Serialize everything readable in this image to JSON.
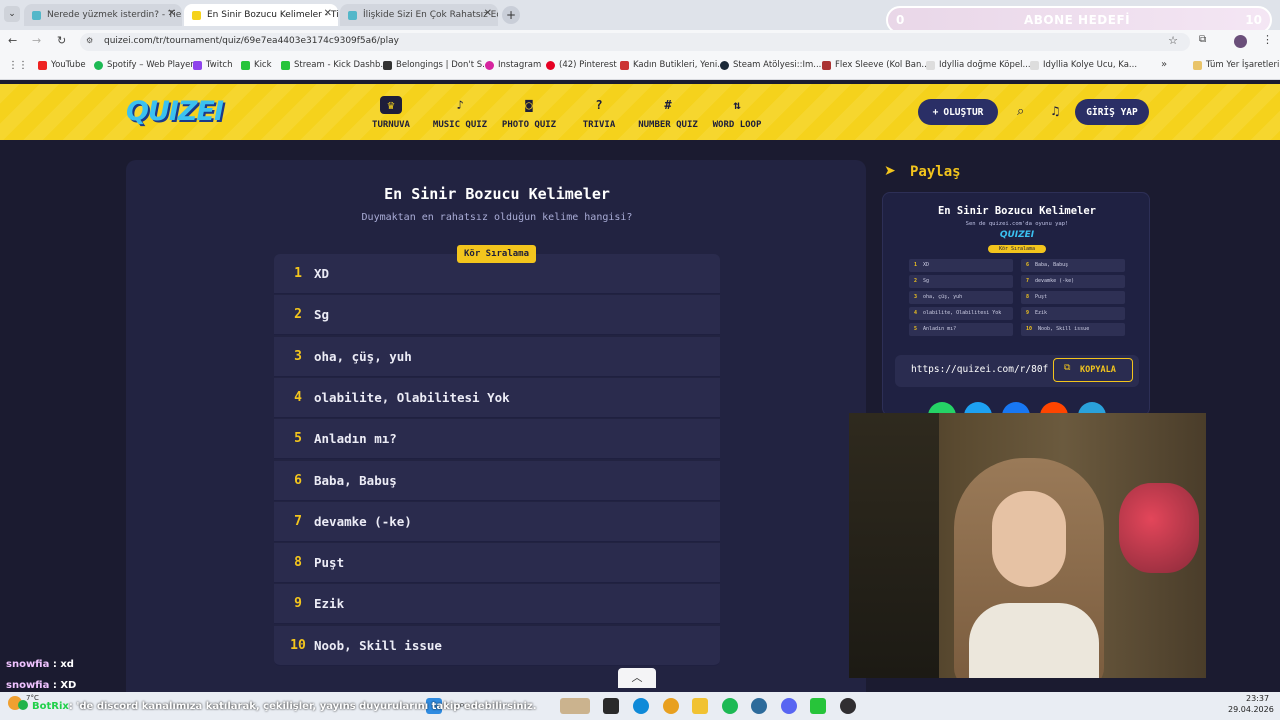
{
  "browser": {
    "tabs": [
      {
        "label": "Nerede yüzmek isterdin? - Tier"
      },
      {
        "label": "En Sinir Bozucu Kelimeler - Tier"
      },
      {
        "label": "İlişkide Sizi En Çok Rahatsız Eden"
      }
    ],
    "url": "quizei.com/tr/tournament/quiz/69e7ea4403e3174c9309f5a6/play",
    "bookmarks": [
      "YouTube",
      "Spotify – Web Player",
      "Twitch",
      "Kick",
      "Stream - Kick Dashb...",
      "Belongings | Don't S...",
      "Instagram",
      "(42) Pinterest",
      "Kadın Butikleri, Yeni...",
      "Steam Atölyesi::Im...",
      "Flex Sleeve (Kol Ban...",
      "Idyllia doğme Köpel...",
      "Idyllia Kolye Ucu, Ka..."
    ],
    "all_bookmarks": "Tüm Yer İşaretleri"
  },
  "overlay_goal": {
    "left": "0",
    "label": "ABONE HEDEFİ",
    "right": "10"
  },
  "site": {
    "logo": "QUIZEI",
    "nav": [
      {
        "label": "TURNUVA",
        "icon": "trophy-icon"
      },
      {
        "label": "MUSIC QUIZ",
        "icon": "music-note-icon"
      },
      {
        "label": "PHOTO QUIZ",
        "icon": "camera-icon"
      },
      {
        "label": "TRIVIA",
        "icon": "question-icon"
      },
      {
        "label": "NUMBER QUIZ",
        "icon": "hash-icon"
      },
      {
        "label": "WORD LOOP",
        "icon": "sort-icon"
      }
    ],
    "create_label": "OLUŞTUR",
    "login_label": "GİRİŞ YAP"
  },
  "quiz": {
    "title": "En Sinir Bozucu Kelimeler",
    "subtitle": "Duymaktan en rahatsız olduğun kelime hangisi?",
    "badge": "Kör Sıralama",
    "items": [
      {
        "rank": "1",
        "text": "XD"
      },
      {
        "rank": "2",
        "text": "Sg"
      },
      {
        "rank": "3",
        "text": "oha, çüş, yuh"
      },
      {
        "rank": "4",
        "text": "olabilite, Olabilitesi Yok"
      },
      {
        "rank": "5",
        "text": "Anladın mı?"
      },
      {
        "rank": "6",
        "text": "Baba, Babuş"
      },
      {
        "rank": "7",
        "text": "devamke (-ke)"
      },
      {
        "rank": "8",
        "text": "Puşt"
      },
      {
        "rank": "9",
        "text": "Ezik"
      },
      {
        "rank": "10",
        "text": "Noob, Skill issue"
      }
    ]
  },
  "share": {
    "heading": "Paylaş",
    "card_title": "En Sinir Bozucu Kelimeler",
    "card_subtitle": "Sen de quizei.com'da oyunu yap!",
    "card_logo": "QUIZEI",
    "card_badge": "Kör Sıralama",
    "link": "https://quizei.com/r/80f",
    "copy_label": "KOPYALA"
  },
  "chat": [
    {
      "user": "snowfia",
      "msg": "xd"
    },
    {
      "user": "snowfia",
      "msg": "XD"
    }
  ],
  "ticker": {
    "user": "BotRix",
    "msg": ": 'de discord kanalımıza katılarak, çekilişler, yayıns duyurularını takip edebilirsiniz."
  },
  "taskbar": {
    "time": "23:37",
    "date": "29.04.2026",
    "weather": "7°C"
  },
  "colors": {
    "accent": "#f3c51d",
    "panel": "#222341",
    "header": "#f5d21c",
    "pill": "#2a2f66"
  }
}
